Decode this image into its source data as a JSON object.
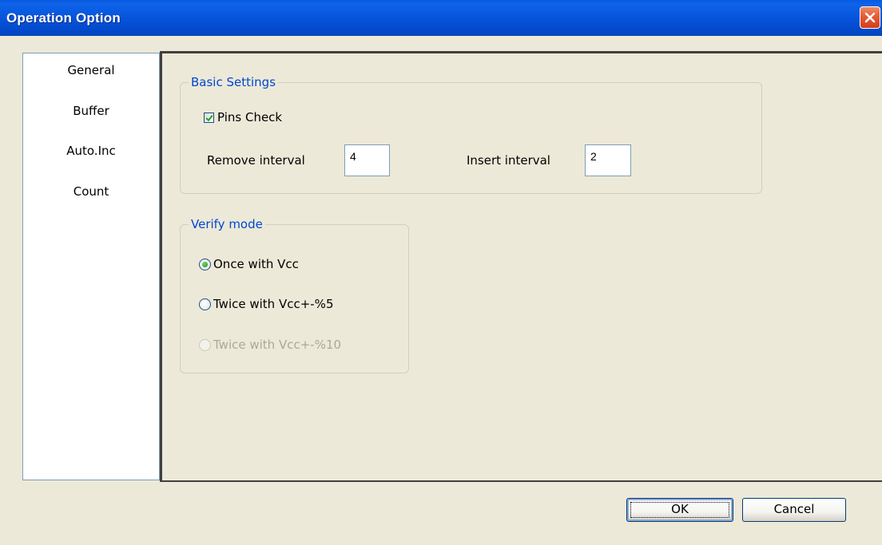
{
  "window": {
    "title": "Operation Option"
  },
  "tabs": [
    {
      "label": "General"
    },
    {
      "label": "Buffer"
    },
    {
      "label": "Auto.Inc"
    },
    {
      "label": "Count"
    }
  ],
  "basic_settings": {
    "legend": "Basic Settings",
    "pins_check": {
      "label": "Pins Check",
      "checked": true
    },
    "remove_interval": {
      "label": "Remove interval",
      "value": "4"
    },
    "insert_interval": {
      "label": "Insert interval",
      "value": "2"
    }
  },
  "verify_mode": {
    "legend": "Verify mode",
    "options": [
      {
        "label": "Once with Vcc",
        "selected": true,
        "enabled": true
      },
      {
        "label": "Twice with Vcc+-%5",
        "selected": false,
        "enabled": true
      },
      {
        "label": "Twice with Vcc+-%10",
        "selected": false,
        "enabled": false
      }
    ]
  },
  "buttons": {
    "ok": "OK",
    "cancel": "Cancel"
  },
  "colors": {
    "titlebar": "#0654db",
    "legend_text": "#0046d5",
    "dialog_bg": "#ece9d8",
    "close_button": "#e55b36",
    "radio_selected": "#1e8a1e",
    "disabled_text": "#aca899"
  }
}
